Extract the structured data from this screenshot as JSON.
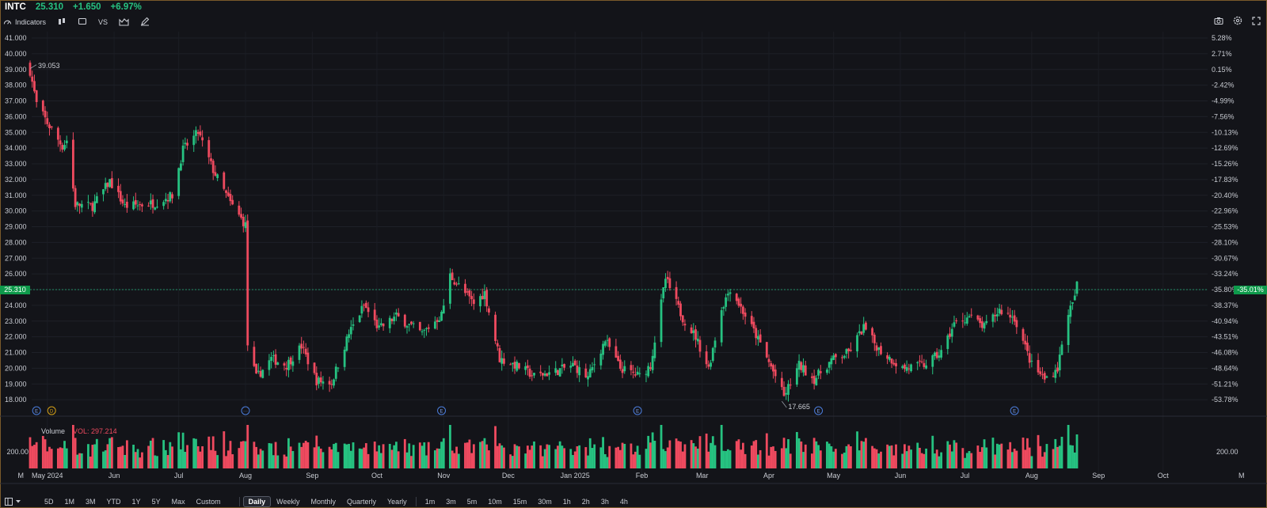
{
  "header": {
    "symbol": "INTC",
    "last": "25.310",
    "change": "+1.650",
    "change_pct": "+6.97%"
  },
  "toolbar": {
    "indicators_label": "Indicators",
    "vs_label": "VS"
  },
  "price_axis": {
    "labels": [
      "41.000",
      "40.000",
      "39.000",
      "38.000",
      "37.000",
      "36.000",
      "35.000",
      "34.000",
      "33.000",
      "32.000",
      "31.000",
      "30.000",
      "29.000",
      "28.000",
      "27.000",
      "26.000",
      "25.000",
      "24.000",
      "23.000",
      "22.000",
      "21.000",
      "20.000",
      "19.000",
      "18.000"
    ],
    "values": [
      41,
      40,
      39,
      38,
      37,
      36,
      35,
      34,
      33,
      32,
      31,
      30,
      29,
      28,
      27,
      26,
      25,
      24,
      23,
      22,
      21,
      20,
      19,
      18
    ],
    "current_tag": "25.310"
  },
  "pct_axis": {
    "labels": [
      "5.28%",
      "2.71%",
      "0.15%",
      "-2.42%",
      "-4.99%",
      "-7.56%",
      "-10.13%",
      "-12.69%",
      "-15.26%",
      "-17.83%",
      "-20.40%",
      "-22.96%",
      "-25.53%",
      "-28.10%",
      "-30.67%",
      "-33.24%",
      "-35.80%",
      "-38.37%",
      "-40.94%",
      "-43.51%",
      "-46.08%",
      "-48.64%",
      "-51.21%",
      "-53.78%"
    ],
    "current_tag": "-35.01%"
  },
  "annotations": {
    "high": "39.053",
    "low": "17.665"
  },
  "event_markers": [
    "E",
    "D",
    "···",
    "E",
    "E",
    "E",
    "E"
  ],
  "volume": {
    "title": "Volume",
    "value": "VOL: 297.214",
    "axis_left": "200.00",
    "axis_left_unit": "M",
    "axis_right": "200.00",
    "axis_right_unit": "M"
  },
  "x_axis": {
    "labels": [
      "May 2024",
      "Jun",
      "Jul",
      "Aug",
      "Sep",
      "Oct",
      "Nov",
      "Dec",
      "Jan 2025",
      "Feb",
      "Mar",
      "Apr",
      "May",
      "Jun",
      "Jul",
      "Aug",
      "Sep",
      "Oct"
    ]
  },
  "range_buttons": [
    "5D",
    "1M",
    "3M",
    "YTD",
    "1Y",
    "5Y",
    "Max",
    "Custom"
  ],
  "interval_buttons": [
    "Daily",
    "Weekly",
    "Monthly",
    "Quarterly",
    "Yearly",
    "1m",
    "3m",
    "5m",
    "10m",
    "15m",
    "30m",
    "1h",
    "2h",
    "3h",
    "4h"
  ],
  "active_interval": "Daily",
  "colors": {
    "up": "#26c281",
    "down": "#ef4a5f",
    "bg": "#131419",
    "tag": "#0e9a4b"
  },
  "chart_data": {
    "type": "candlestick",
    "title": "",
    "ylim": [
      17.5,
      41.5
    ],
    "anchors": [
      [
        "2024-04-23",
        38.9
      ],
      [
        "2024-04-26",
        36.8
      ],
      [
        "2024-05-01",
        35.6
      ],
      [
        "2024-05-08",
        34.1
      ],
      [
        "2024-05-10",
        34.5
      ],
      [
        "2024-05-14",
        30.4
      ],
      [
        "2024-05-22",
        30.3
      ],
      [
        "2024-05-30",
        31.9
      ],
      [
        "2024-06-06",
        30.3
      ],
      [
        "2024-06-20",
        30.5
      ],
      [
        "2024-06-28",
        31.0
      ],
      [
        "2024-07-03",
        33.9
      ],
      [
        "2024-07-10",
        35.0
      ],
      [
        "2024-07-17",
        32.6
      ],
      [
        "2024-07-25",
        30.5
      ],
      [
        "2024-08-01",
        29.1
      ],
      [
        "2024-08-02",
        21.5
      ],
      [
        "2024-08-06",
        19.4
      ],
      [
        "2024-08-13",
        20.6
      ],
      [
        "2024-08-20",
        20.2
      ],
      [
        "2024-08-27",
        21.4
      ],
      [
        "2024-09-03",
        19.2
      ],
      [
        "2024-09-10",
        19.1
      ],
      [
        "2024-09-18",
        22.2
      ],
      [
        "2024-09-25",
        24.0
      ],
      [
        "2024-10-02",
        22.5
      ],
      [
        "2024-10-10",
        23.3
      ],
      [
        "2024-10-22",
        22.2
      ],
      [
        "2024-10-31",
        23.4
      ],
      [
        "2024-11-04",
        25.9
      ],
      [
        "2024-11-15",
        24.1
      ],
      [
        "2024-11-20",
        24.8
      ],
      [
        "2024-11-27",
        20.6
      ],
      [
        "2024-12-06",
        20.1
      ],
      [
        "2024-12-13",
        19.5
      ],
      [
        "2024-12-23",
        19.8
      ],
      [
        "2024-12-31",
        20.2
      ],
      [
        "2025-01-07",
        19.4
      ],
      [
        "2025-01-15",
        21.8
      ],
      [
        "2025-01-22",
        20.0
      ],
      [
        "2025-01-31",
        19.5
      ],
      [
        "2025-02-05",
        20.2
      ],
      [
        "2025-02-12",
        25.7
      ],
      [
        "2025-02-20",
        23.2
      ],
      [
        "2025-02-26",
        22.0
      ],
      [
        "2025-03-04",
        20.0
      ],
      [
        "2025-03-10",
        23.8
      ],
      [
        "2025-03-14",
        25.1
      ],
      [
        "2025-03-26",
        22.1
      ],
      [
        "2025-04-04",
        19.5
      ],
      [
        "2025-04-08",
        18.2
      ],
      [
        "2025-04-15",
        20.2
      ],
      [
        "2025-04-22",
        19.3
      ],
      [
        "2025-04-30",
        20.5
      ],
      [
        "2025-05-08",
        21.0
      ],
      [
        "2025-05-15",
        22.6
      ],
      [
        "2025-05-22",
        21.2
      ],
      [
        "2025-06-02",
        20.0
      ],
      [
        "2025-06-12",
        20.2
      ],
      [
        "2025-06-20",
        21.0
      ],
      [
        "2025-06-26",
        22.8
      ],
      [
        "2025-07-03",
        23.3
      ],
      [
        "2025-07-10",
        22.6
      ],
      [
        "2025-07-17",
        23.7
      ],
      [
        "2025-07-24",
        23.2
      ],
      [
        "2025-08-01",
        20.2
      ],
      [
        "2025-08-07",
        19.3
      ],
      [
        "2025-08-13",
        20.0
      ],
      [
        "2025-08-18",
        23.6
      ],
      [
        "2025-08-20",
        24.0
      ],
      [
        "2025-08-22",
        25.3
      ]
    ]
  }
}
